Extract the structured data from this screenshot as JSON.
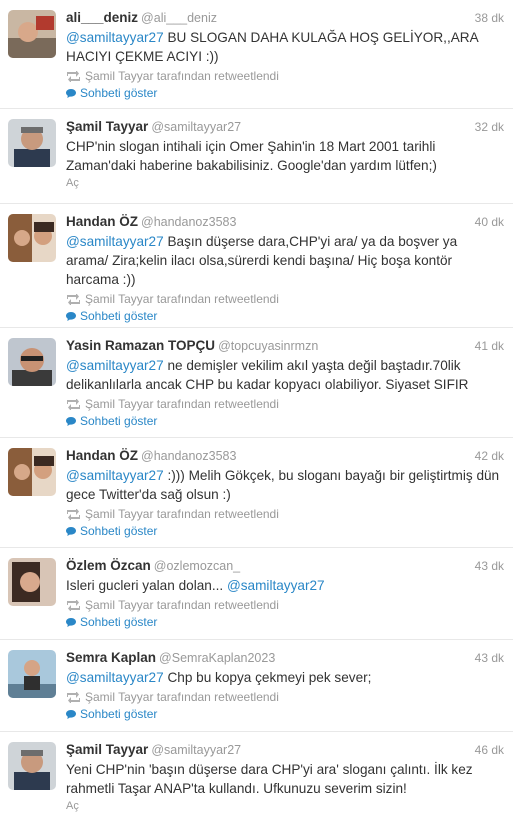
{
  "tweets": [
    {
      "name": "ali___deniz",
      "handle": "@ali___deniz",
      "time": "38 dk",
      "mention": "@samiltayyar27",
      "text": " BU SLOGAN DAHA KULAĞA HOŞ GELİYOR,,ARA HACIYI ÇEKME ACIYI :))",
      "retweet_label": "Şamil Tayyar tarafından retweetlendi",
      "conversation_label": "Sohbeti göster"
    },
    {
      "name": "Şamil Tayyar",
      "handle": "@samiltayyar27",
      "time": "32 dk",
      "mention": "",
      "text": "CHP'nin slogan intihali için Omer Şahin'in 18 Mart 2001 tarihli Zaman'daki haberine bakabilisiniz. Google'dan yardım lütfen;)",
      "expand_label": "Aç"
    },
    {
      "name": "Handan ÖZ",
      "handle": "@handanoz3583",
      "time": "40 dk",
      "mention": "@samiltayyar27",
      "text": " Başın düşerse dara,CHP'yi ara/ ya da boşver ya arama/ Zira;kelin ilacı olsa,sürerdi kendi başına/ Hiç boşa kontör harcama :))",
      "retweet_label": "Şamil Tayyar tarafından retweetlendi",
      "conversation_label": "Sohbeti göster"
    },
    {
      "name": "Yasin Ramazan TOPÇU",
      "handle": "@topcuyasinrmzn",
      "time": "41 dk",
      "mention": "@samiltayyar27",
      "text": " ne demişler vekilim akıl yaşta değil baştadır.70lik delikanlılarla ancak CHP bu kadar kopyacı olabiliyor. Siyaset SIFIR",
      "retweet_label": "Şamil Tayyar tarafından retweetlendi",
      "conversation_label": "Sohbeti göster"
    },
    {
      "name": "Handan ÖZ",
      "handle": "@handanoz3583",
      "time": "42 dk",
      "mention": "@samiltayyar27",
      "text": " :))) Melih Gökçek, bu sloganı bayağı bir geliştirtmiş dün gece Twitter'da sağ olsun :)",
      "retweet_label": "Şamil Tayyar tarafından retweetlendi",
      "conversation_label": "Sohbeti göster"
    },
    {
      "name": "Özlem Özcan",
      "handle": "@ozlemozcan_",
      "time": "43 dk",
      "mention_after": "@samiltayyar27",
      "text": "Isleri gucleri yalan dolan... ",
      "retweet_label": "Şamil Tayyar tarafından retweetlendi",
      "conversation_label": "Sohbeti göster"
    },
    {
      "name": "Semra Kaplan",
      "handle": "@SemraKaplan2023",
      "time": "43 dk",
      "mention": "@samiltayyar27",
      "text": " Chp bu kopya çekmeyi pek sever;",
      "retweet_label": "Şamil Tayyar tarafından retweetlendi",
      "conversation_label": "Sohbeti göster"
    },
    {
      "name": "Şamil Tayyar",
      "handle": "@samiltayyar27",
      "time": "46 dk",
      "mention": "",
      "text": "Yeni CHP'nin 'başın düşerse dara CHP'yi ara' sloganı çalıntı. İlk kez rahmetli Taşar ANAP'ta kullandı. Ufkunuzu severim sizin!",
      "expand_label": "Aç"
    }
  ],
  "colors": {
    "link": "#2a87c7",
    "muted": "#999999",
    "text": "#333333",
    "divider": "#e8e8e8"
  }
}
